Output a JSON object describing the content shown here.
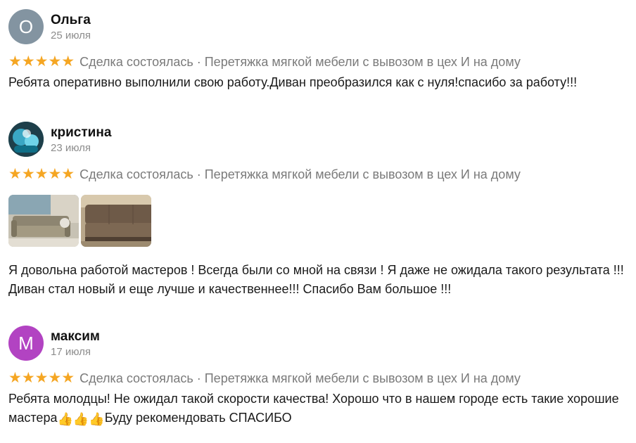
{
  "reviews": [
    {
      "avatar_letter": "О",
      "avatar_color": "#8394a1",
      "name": "Ольга",
      "date": "25 июля",
      "stars": "★★★★★",
      "deal": "Сделка состоялась · Перетяжка мягкой мебели с вывозом в цех И на дому",
      "text": "Ребята оперативно выполнили свою работу.Диван преобразился как с нуля!спасибо за работу!!!"
    },
    {
      "avatar_letter": "",
      "avatar_color": "#2f7d86",
      "name": "кристина",
      "date": "23 июля",
      "stars": "★★★★★",
      "deal": "Сделка состоялась · Перетяжка мягкой мебели с вывозом в цех И на дому",
      "photos": [
        "sofa-before",
        "sofa-after"
      ],
      "text": "Я довольна работой мастеров ! Всегда были со мной на связи ! Я даже не ожидала такого результата !!! Диван стал новый и еще лучше и качественнее!!! Спасибо Вам большое !!!"
    },
    {
      "avatar_letter": "М",
      "avatar_color": "#b243c2",
      "name": "максим",
      "date": "17 июля",
      "stars": "★★★★★",
      "deal": "Сделка состоялась · Перетяжка мягкой мебели с вывозом в цех И на дому",
      "text_1": "Ребята молодцы! Не ожидал такой скорости качества! Хорошо что в нашем городе есть такие хорошие мастера",
      "text_emoji": "👍👍👍",
      "text_2": "Буду рекомендовать СПАСИБО"
    }
  ]
}
